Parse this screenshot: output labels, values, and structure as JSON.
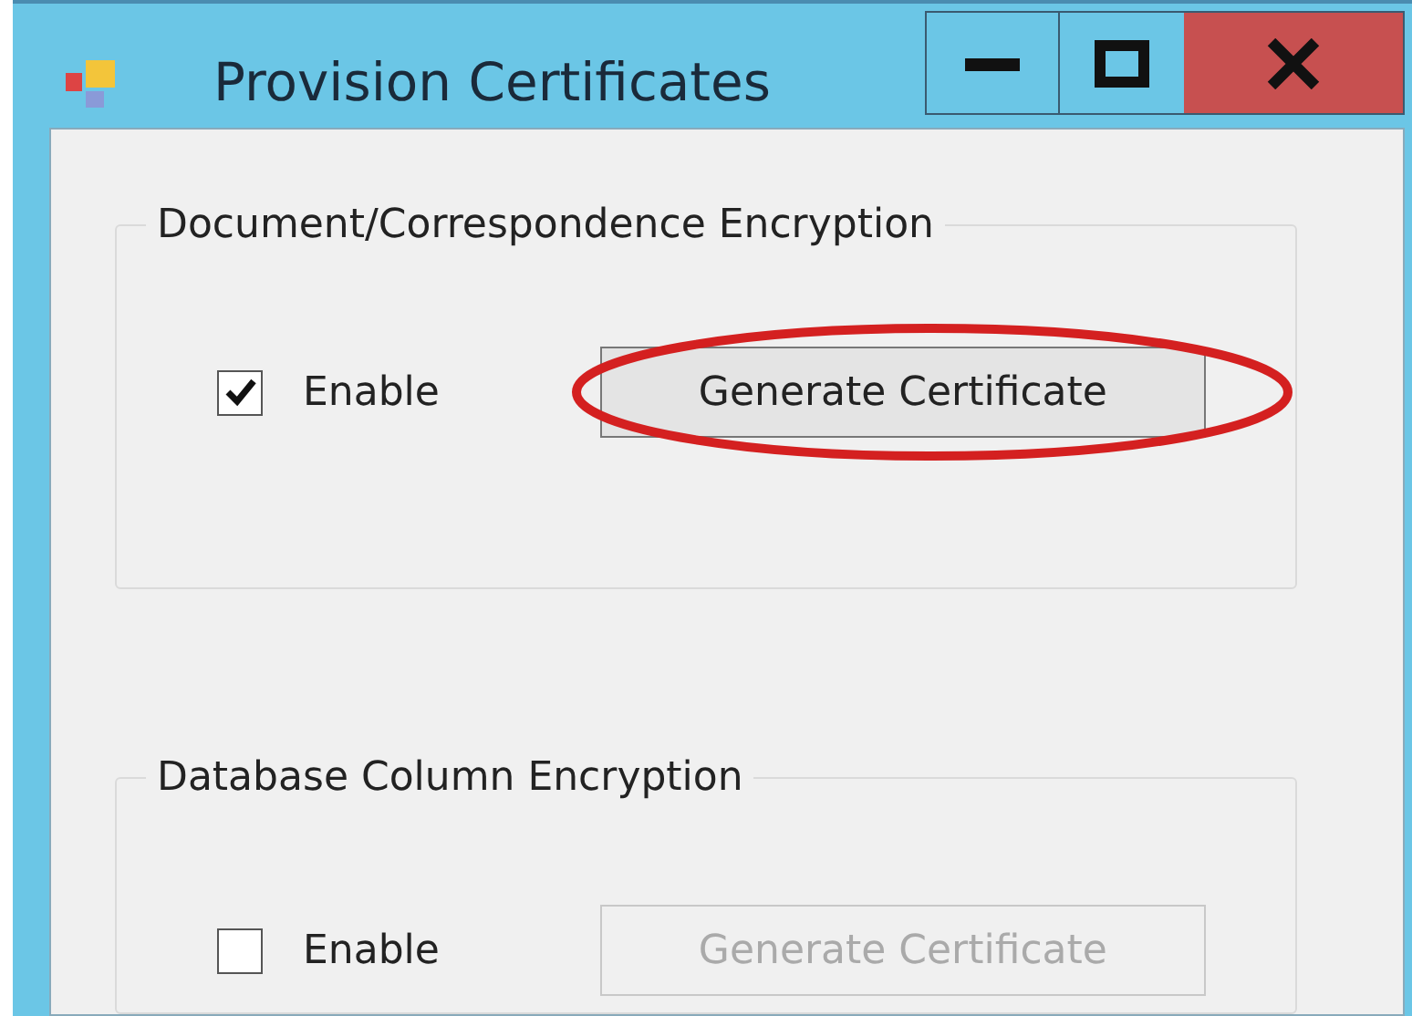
{
  "window": {
    "title": "Provision Certificates"
  },
  "sections": [
    {
      "title": "Document/Correspondence Encryption",
      "enable_label": "Enable",
      "checked": true,
      "button": "Generate Certificate",
      "button_disabled": false,
      "highlighted": true
    },
    {
      "title": "Database Column Encryption",
      "enable_label": "Enable",
      "checked": false,
      "button": "Generate Certificate",
      "button_disabled": true,
      "highlighted": false
    }
  ]
}
